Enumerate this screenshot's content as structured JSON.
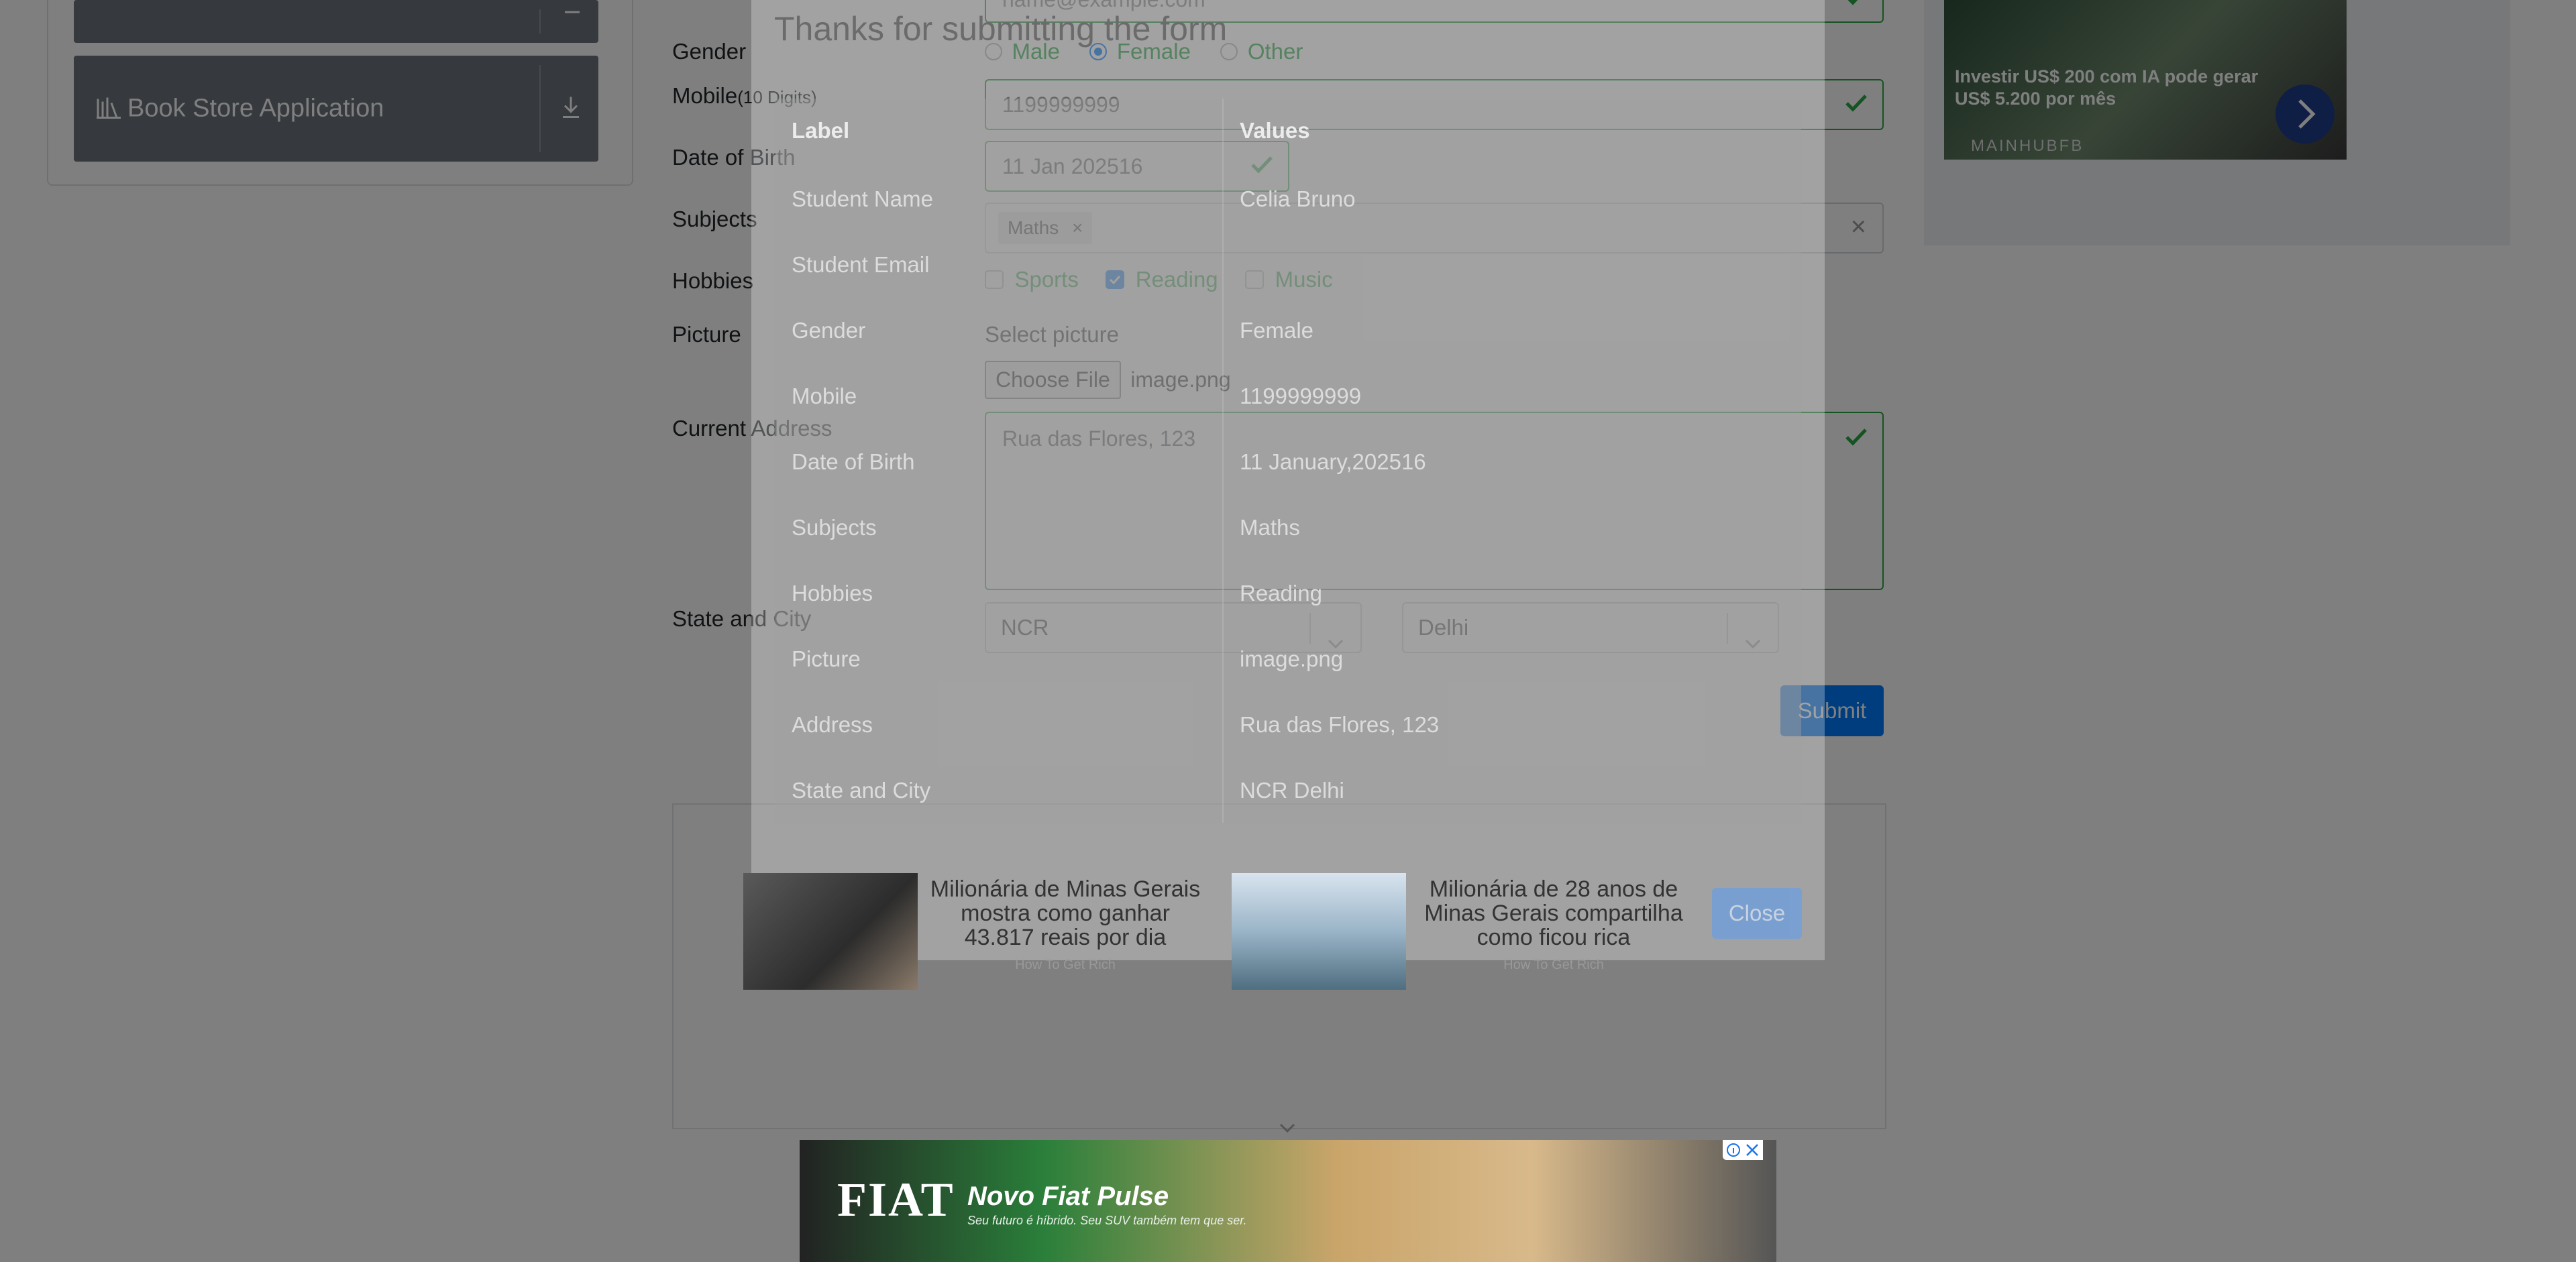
{
  "sidebar": {
    "items": [
      {
        "label": ""
      },
      {
        "label": "Book Store Application"
      }
    ]
  },
  "form": {
    "email_placeholder": "name@example.com",
    "gender_label": "Gender",
    "gender_options": [
      "Male",
      "Female",
      "Other"
    ],
    "gender_selected": "Female",
    "mobile_label": "Mobile",
    "mobile_hint": "(10 Digits)",
    "mobile_value": "1199999999",
    "dob_label": "Date of Birth",
    "dob_value": "11 Jan 202516",
    "subjects_label": "Subjects",
    "subjects_tags": [
      "Maths"
    ],
    "subjects_clear": "×",
    "hobbies_label": "Hobbies",
    "hobbies": [
      {
        "label": "Sports",
        "checked": false
      },
      {
        "label": "Reading",
        "checked": true
      },
      {
        "label": "Music",
        "checked": false
      }
    ],
    "picture_label": "Picture",
    "select_picture": "Select picture",
    "choose_file": "Choose File",
    "file_name": "image.png",
    "address_label": "Current Address",
    "address_value": "Rua das Flores, 123",
    "state_city_label": "State and City",
    "state_value": "NCR",
    "city_value": "Delhi",
    "submit_label": "Submit"
  },
  "modal": {
    "title": "Thanks for submitting the form",
    "table_headers": {
      "label": "Label",
      "values": "Values"
    },
    "rows": [
      {
        "label": "Student Name",
        "value": "Celia Bruno"
      },
      {
        "label": "Student Email",
        "value": ""
      },
      {
        "label": "Gender",
        "value": "Female"
      },
      {
        "label": "Mobile",
        "value": "1199999999"
      },
      {
        "label": "Date of Birth",
        "value": "11 January,202516"
      },
      {
        "label": "Subjects",
        "value": "Maths"
      },
      {
        "label": "Hobbies",
        "value": "Reading"
      },
      {
        "label": "Picture",
        "value": "image.png"
      },
      {
        "label": "Address",
        "value": "Rua das Flores, 123"
      },
      {
        "label": "State and City",
        "value": "NCR Delhi"
      }
    ],
    "close_label": "Close"
  },
  "ads": {
    "side_ad": {
      "text": "Investir US$ 200 com IA pode gerar US$ 5.200 por mês",
      "brand": "MAINHUBFB"
    },
    "native": [
      {
        "title": "Milionária de Minas Gerais mostra como ganhar 43.817 reais por dia",
        "source": "How To Get Rich"
      },
      {
        "title": "Milionária de 28 anos de Minas Gerais compartilha como ficou rica",
        "source": "How To Get Rich"
      }
    ],
    "banner": {
      "brand": "FIAT",
      "headline": "Novo Fiat Pulse",
      "tagline": "Seu futuro é híbrido. Seu SUV também tem que ser."
    }
  },
  "colors": {
    "accent": "#007bff",
    "valid": "#28a745",
    "sidebar_button": "#6c757d"
  }
}
